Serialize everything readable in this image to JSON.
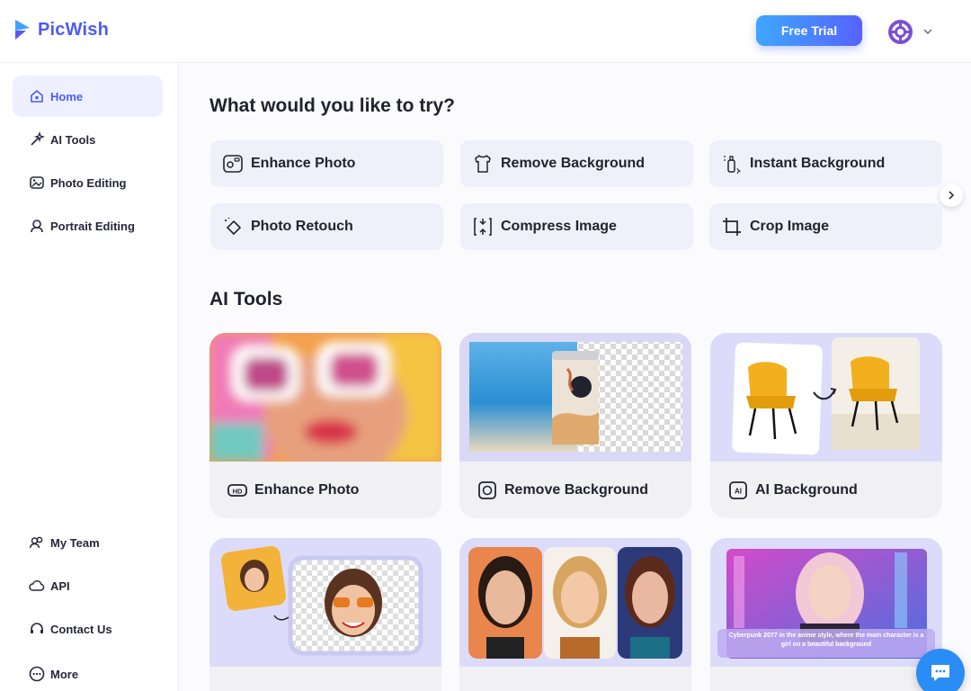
{
  "header": {
    "brand": "PicWish",
    "trial_label": "Free Trial"
  },
  "sidebar": {
    "items": [
      {
        "label": "Home",
        "icon": "home-icon"
      },
      {
        "label": "AI Tools",
        "icon": "magic-wand-icon"
      },
      {
        "label": "Photo Editing",
        "icon": "photo-edit-icon"
      },
      {
        "label": "Portrait Editing",
        "icon": "portrait-icon"
      }
    ],
    "bottom_items": [
      {
        "label": "My Team",
        "icon": "team-icon"
      },
      {
        "label": "API",
        "icon": "api-cloud-icon"
      },
      {
        "label": "Contact Us",
        "icon": "headset-icon"
      },
      {
        "label": "More",
        "icon": "more-icon"
      }
    ]
  },
  "main": {
    "try_title": "What would you like to try?",
    "quick_actions": [
      {
        "label": "Enhance Photo",
        "icon": "hd-photo-icon"
      },
      {
        "label": "Remove Background",
        "icon": "shirt-icon"
      },
      {
        "label": "Instant Background",
        "icon": "bottle-sparkle-icon"
      },
      {
        "label": "Photo Retouch",
        "icon": "eraser-icon"
      },
      {
        "label": "Compress Image",
        "icon": "compress-icon"
      },
      {
        "label": "Crop Image",
        "icon": "crop-icon"
      }
    ],
    "ai_title": "AI Tools",
    "cards": [
      {
        "label": "Enhance Photo",
        "icon": "hd-icon"
      },
      {
        "label": "Remove Background",
        "icon": "remove-bg-icon"
      },
      {
        "label": "AI Background",
        "icon": "ai-bg-icon"
      }
    ],
    "cyber_caption": "Cyberpunk 2077 in the anime style, where the main character is a girl on a beautiful background"
  },
  "colors": {
    "brand": "#4b5bf6",
    "active_bg": "#eef0ff",
    "chat": "#2a8cf5"
  }
}
